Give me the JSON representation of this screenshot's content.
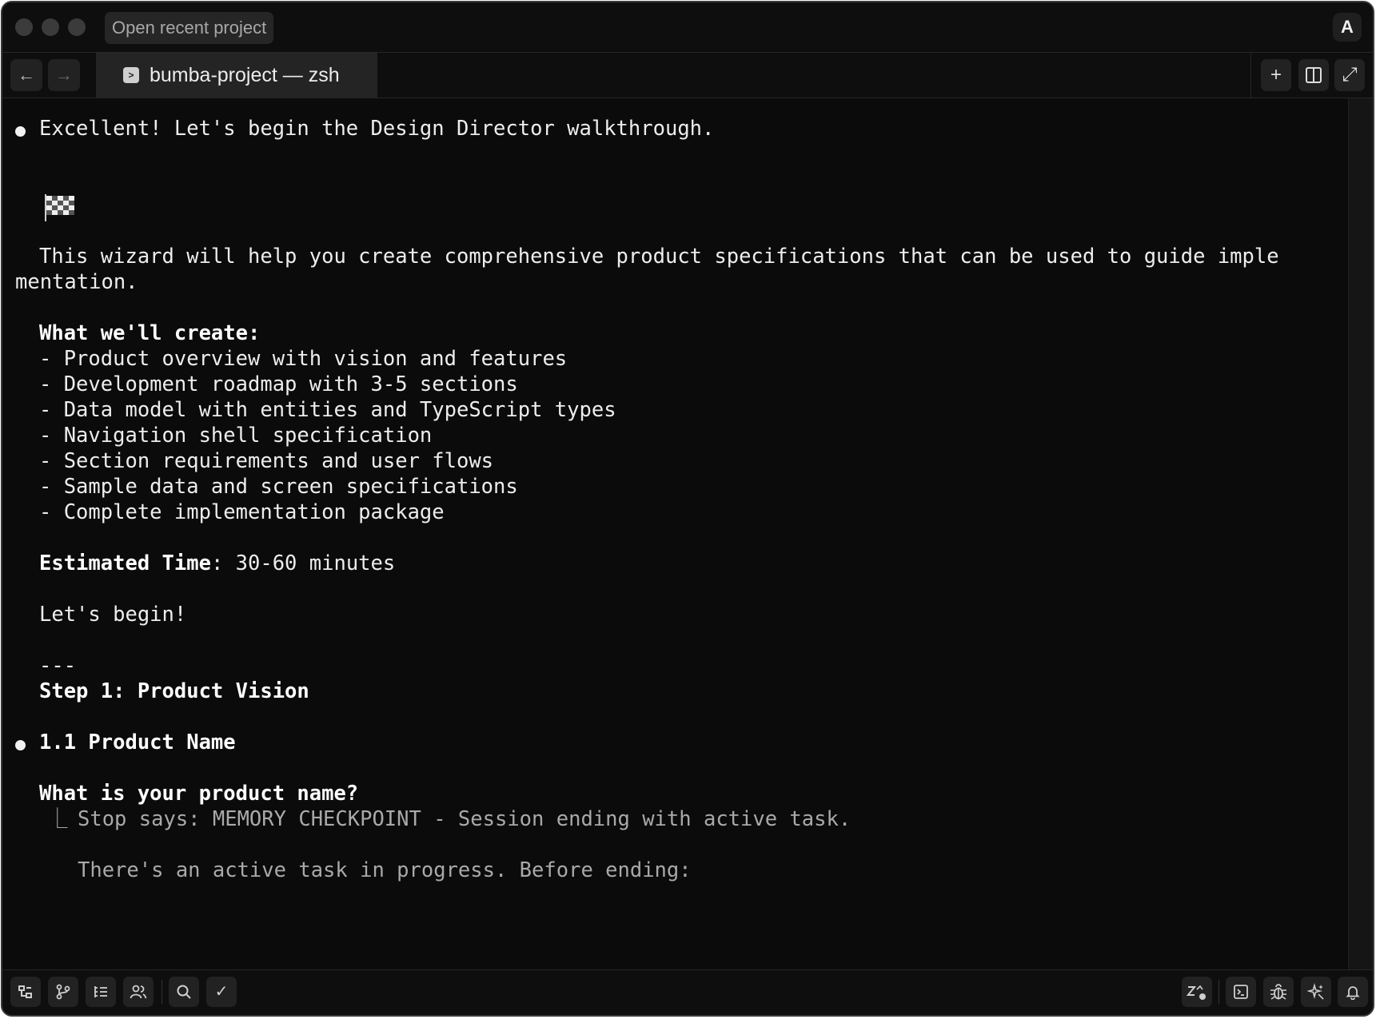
{
  "titlebar": {
    "recent_project_label": "Open recent project",
    "account_initial": "A"
  },
  "tabbar": {
    "back_icon": "arrow-left-icon",
    "forward_icon": "arrow-right-icon",
    "tab_title": "bumba-project — zsh",
    "tab_icon": "terminal-icon",
    "actions": [
      "plus-icon",
      "split-pane-icon",
      "expand-icon"
    ]
  },
  "terminal": {
    "intro": "Excellent! Let's begin the Design Director walkthrough.",
    "flag_emoji": "🏁",
    "desc_line1": "This wizard will help you create comprehensive product specifications that can be used to guide imple",
    "desc_line2": "mentation.",
    "create_heading": "What we'll create:",
    "create_items": [
      "- Product overview with vision and features",
      "- Development roadmap with 3-5 sections",
      "- Data model with entities and TypeScript types",
      "- Navigation shell specification",
      "- Section requirements and user flows",
      "- Sample data and screen specifications",
      "- Complete implementation package"
    ],
    "time_label": "Estimated Time",
    "time_value": ": 30-60 minutes",
    "begin": "Let's begin!",
    "divider": "---",
    "step_heading": "Step 1: Product Vision",
    "section_heading": "1.1 Product Name",
    "question": "What is your product name?",
    "hook_prefix": "⎿",
    "hook_line": "Stop says: MEMORY CHECKPOINT - Session ending with active task.",
    "hook_followup": "There's an active task in progress. Before ending:"
  },
  "statusbar": {
    "left_icons": [
      "file-tree-icon",
      "git-branch-icon",
      "outline-list-icon",
      "collaborators-icon",
      "search-icon",
      "checkmark-icon"
    ],
    "right_icons": [
      "sleep-zz-icon",
      "terminal-icon",
      "debug-bug-icon",
      "ai-sparkle-icon",
      "bell-icon"
    ],
    "checkmark_glyph": "✓"
  }
}
